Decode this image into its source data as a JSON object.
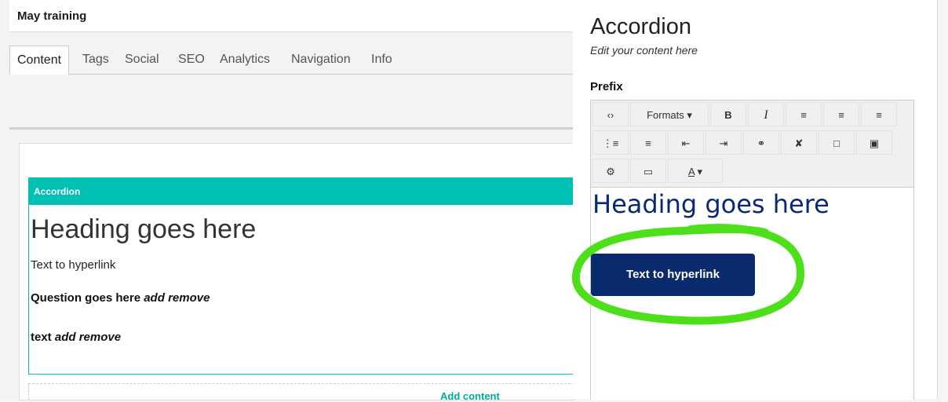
{
  "page": {
    "title": "May training"
  },
  "tabs": [
    {
      "label": "Content"
    },
    {
      "label": "Tags"
    },
    {
      "label": "Social"
    },
    {
      "label": "SEO"
    },
    {
      "label": "Analytics"
    },
    {
      "label": "Navigation"
    },
    {
      "label": "Info"
    }
  ],
  "accordion": {
    "header": "Accordion",
    "heading": "Heading goes here",
    "paragraph": "Text to hyperlink",
    "question": "Question goes here",
    "text": "text",
    "add": "add",
    "remove": "remove"
  },
  "add_content": {
    "label": "Add content"
  },
  "panel": {
    "title": "Accordion",
    "subtitle": "Edit your content here",
    "field_label": "Prefix"
  },
  "toolbar": {
    "source_icon": "code-icon",
    "formats_label": "Formats",
    "bold": "B",
    "italic": "I",
    "text_color_label": "A"
  },
  "editor": {
    "heading": "Heading goes here",
    "button": "Text to hyperlink"
  },
  "colors": {
    "accordion_teal": "#00bfb3",
    "navy": "#0a2a6e",
    "highlight_green": "#4de01a"
  }
}
